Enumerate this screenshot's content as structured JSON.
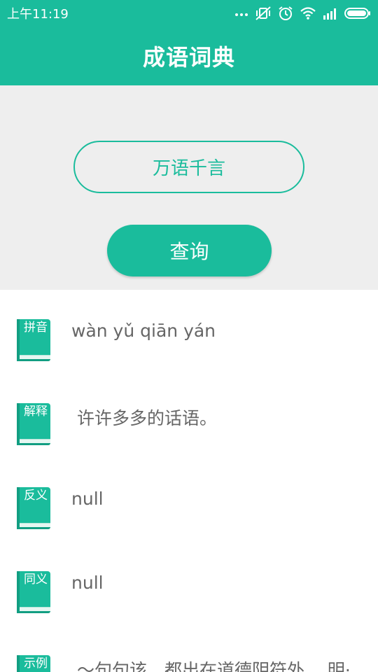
{
  "status_bar": {
    "time": "上午11:19",
    "icons": [
      "more-dots-icon",
      "vibrate-off-icon",
      "alarm-icon",
      "wifi-icon",
      "signal-icon",
      "battery-icon"
    ]
  },
  "app_bar": {
    "title": "成语词典"
  },
  "search": {
    "value": "万语千言",
    "button_label": "查询"
  },
  "colors": {
    "primary": "#1abc9c",
    "primary_dark": "#129e82",
    "background": "#eeeeee",
    "text_secondary": "#666666"
  },
  "results": [
    {
      "icon_label": "拼音",
      "value": "wàn yǔ qiān yán"
    },
    {
      "icon_label": "解释",
      "value": " 许许多多的话语。"
    },
    {
      "icon_label": "反义",
      "value": "null"
    },
    {
      "icon_label": "同义",
      "value": "null"
    },
    {
      "icon_label": "示例",
      "value": " ～句句该，都出在道德阴符外。 明·"
    }
  ]
}
